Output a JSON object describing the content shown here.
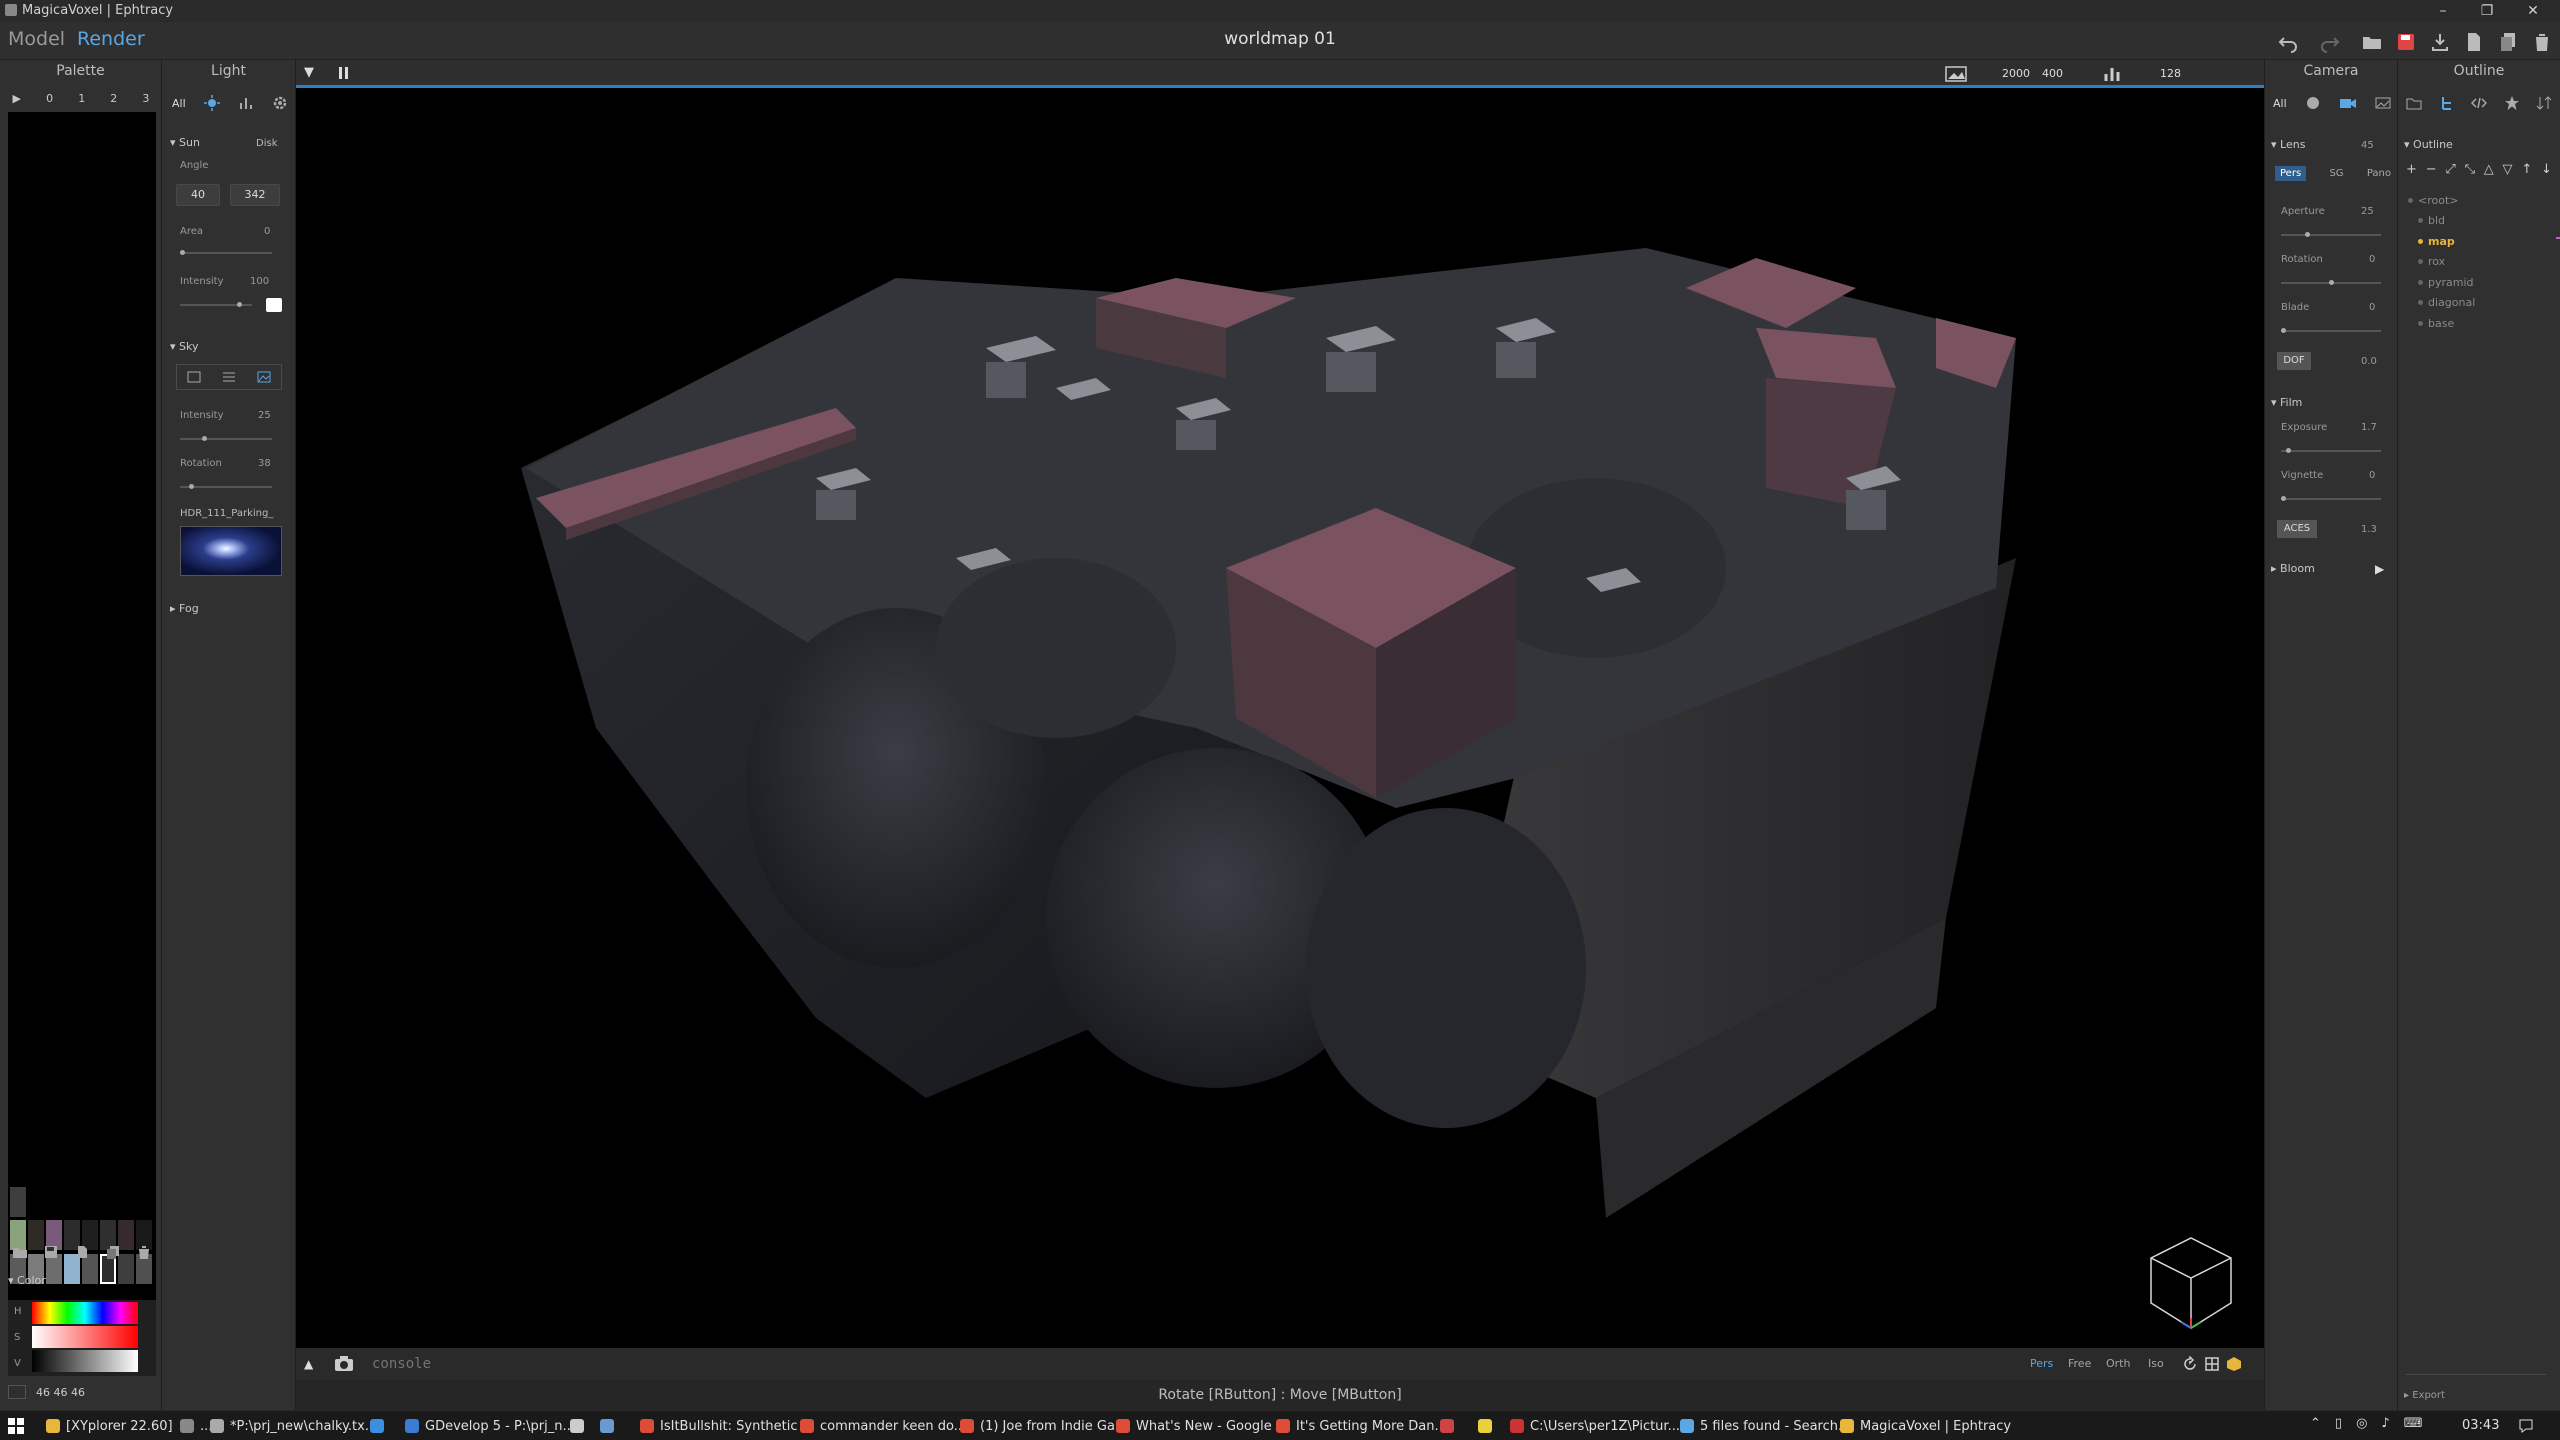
{
  "window": {
    "title": "MagicaVoxel | Ephtracy",
    "controls": [
      "–",
      "❐",
      "✕"
    ]
  },
  "menu": {
    "tabs": [
      "Model",
      "Render"
    ],
    "document_title": "worldmap 01"
  },
  "palette": {
    "header": "Palette",
    "pages": [
      "▶",
      "0",
      "1",
      "2",
      "3"
    ],
    "swatches_row1": [
      "#3e3e3e"
    ],
    "swatches_row2": [
      "#8aa37c",
      "#2e2a24",
      "#7a5a7a",
      "#2c2c2c",
      "#1f1f1f",
      "#2f2f2f",
      "#362a30",
      "#1a1a1a"
    ],
    "swatches_row3": [
      "#5b5b5b",
      "#7b7b7b",
      "#6d6d6d",
      "#8fb3cf",
      "#555555",
      "#2e2e2e",
      "#3e3e3e",
      "#505050"
    ],
    "color_section": "Color",
    "hsv_labels": [
      "H",
      "S",
      "V"
    ],
    "rgb_value": "46  46  46"
  },
  "light": {
    "header": "Light",
    "filters": [
      "All"
    ],
    "sun": {
      "label": "Sun",
      "mode": "Disk",
      "angle_label": "Angle",
      "angle1": "40",
      "angle2": "342",
      "area_label": "Area",
      "area": "0",
      "intensity_label": "Intensity",
      "intensity": "100",
      "area_level": 0.0,
      "intensity_level": 0.85
    },
    "sky": {
      "label": "Sky",
      "intensity_label": "Intensity",
      "intensity": "25",
      "rotation_label": "Rotation",
      "rotation": "38",
      "hdr_name": "HDR_111_Parking_",
      "intensity_level": 0.25,
      "rotation_level": 0.1
    },
    "fog": {
      "label": "Fog"
    }
  },
  "viewport": {
    "resolution_w": "2000",
    "resolution_h": "400",
    "samples": "128",
    "console_placeholder": "console",
    "view_modes": [
      "Pers",
      "Free",
      "Orth",
      "Iso"
    ],
    "active_view": "Pers",
    "status": "Rotate [RButton] : Move [MButton]"
  },
  "camera": {
    "header": "Camera",
    "filters": [
      "All"
    ],
    "lens": {
      "label": "Lens",
      "value": "45",
      "modes": [
        "Pers",
        "SG",
        "Pano"
      ]
    },
    "aperture": {
      "label": "Aperture",
      "value": "25",
      "level": 0.25
    },
    "rotation": {
      "label": "Rotation",
      "value": "0",
      "level": 0.5
    },
    "blade": {
      "label": "Blade",
      "value": "0",
      "level": 0.0
    },
    "dof": {
      "label": "DOF",
      "value": "0.0"
    },
    "film": {
      "label": "Film"
    },
    "exposure": {
      "label": "Exposure",
      "value": "1.7",
      "level": 0.05
    },
    "vignette": {
      "label": "Vignette",
      "value": "0",
      "level": 0.0
    },
    "aces": {
      "label": "ACES",
      "value": "1.3"
    },
    "bloom": {
      "label": "Bloom"
    }
  },
  "outline": {
    "header": "Outline",
    "section": "Outline",
    "items": [
      {
        "name": "<root>",
        "active": false
      },
      {
        "name": "bld",
        "active": false
      },
      {
        "name": "map",
        "active": true
      },
      {
        "name": "rox",
        "active": false
      },
      {
        "name": "pyramid",
        "active": false
      },
      {
        "name": "diagonal",
        "active": false
      },
      {
        "name": "base",
        "active": false
      }
    ],
    "export": "Export",
    "accent": "#e8b63a"
  },
  "taskbar": {
    "items": [
      "[XYplorer 22.60]",
      "...",
      "*P:\\prj_new\\chalky.tx...",
      "",
      "GDevelop 5 - P:\\prj_n...",
      "",
      "",
      "IsItBullshit: Synthetic ...",
      "commander keen do...",
      "(1) Joe from Indie Ga...",
      "What's New - Google ...",
      "It's Getting More Dan...",
      "",
      "",
      "C:\\Users\\per1Z\\Pictur...",
      "5 files found - Search...",
      "MagicaVoxel | Ephtracy"
    ],
    "clock": "03:43"
  },
  "colors": {
    "accent_blue": "#2f7fc4",
    "roof": "#7a5260"
  }
}
